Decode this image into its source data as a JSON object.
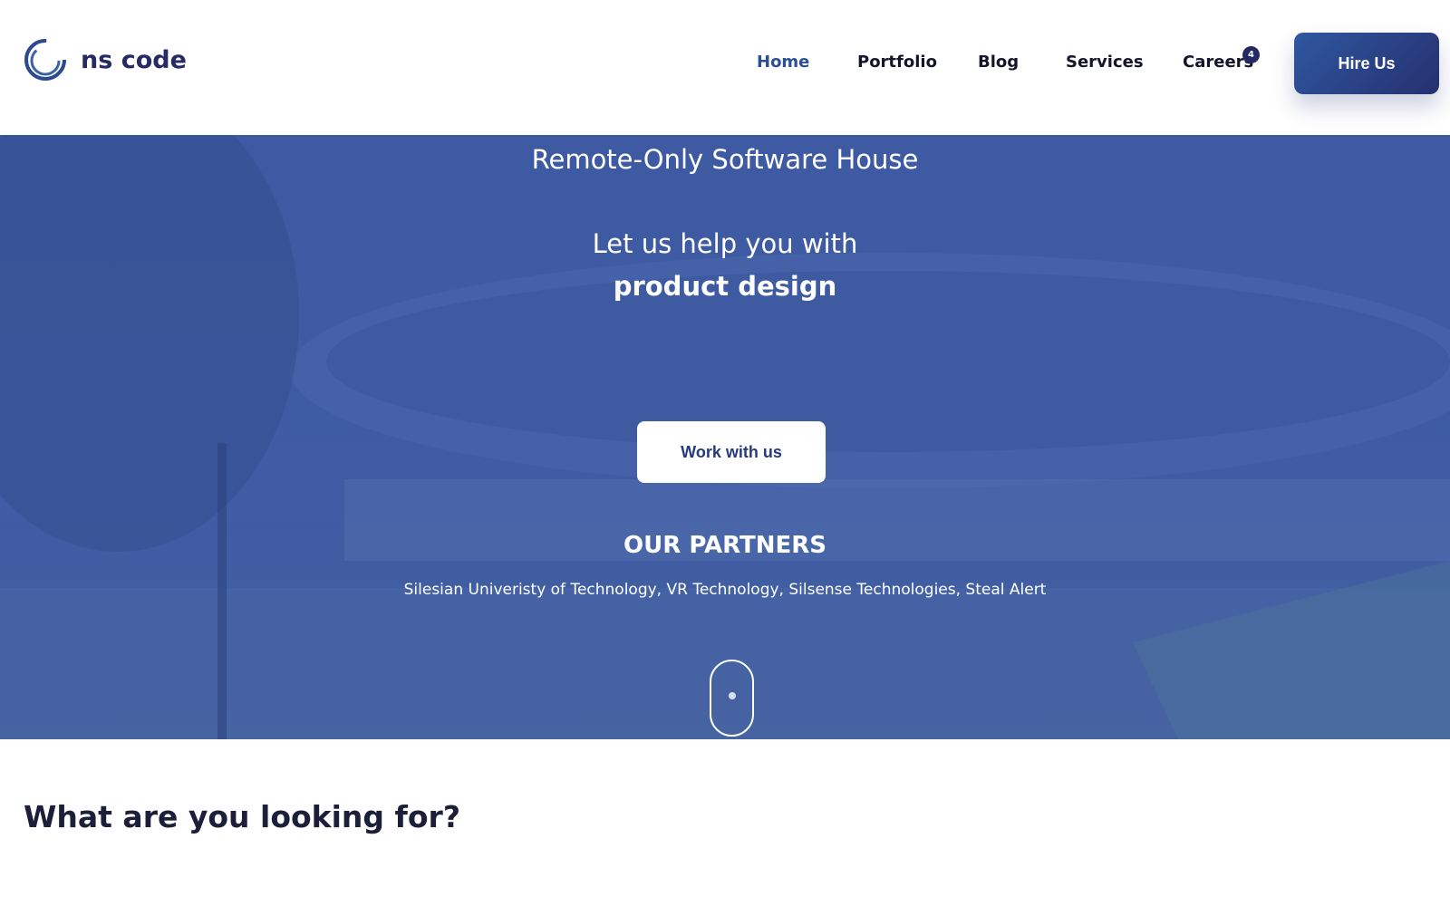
{
  "header": {
    "logo_text": "ns code",
    "nav": [
      "Home",
      "Portfolio",
      "Blog",
      "Services",
      "Careers"
    ],
    "active": "Home",
    "careers_badge": "4",
    "hire_label": "Hire Us"
  },
  "hero": {
    "tagline": "Remote-Only Software House",
    "help_line": "Let us help you with",
    "help_focus": "product design",
    "cta_label": "Work with us",
    "partners_title": "OUR PARTNERS",
    "partners_list": "Silesian Univeristy of Technology, VR Technology, Silsense Technologies, Steal Alert"
  },
  "section": {
    "title": "What are you looking for?"
  },
  "colors": {
    "brand": "#262b63",
    "accent": "#2a4f95",
    "hero_overlay": "#3d5aa3"
  }
}
